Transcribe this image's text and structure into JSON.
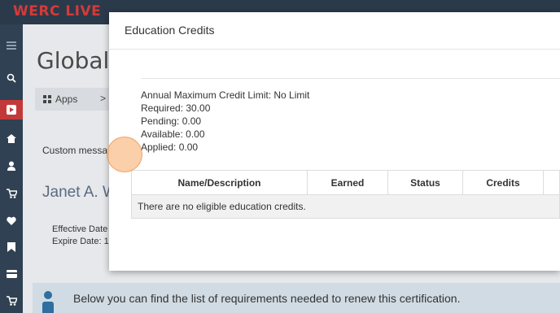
{
  "app": {
    "brand": "WERC LIVE"
  },
  "sidebar": {
    "icons": [
      "menu-icon",
      "search-icon",
      "play-icon",
      "home-icon",
      "user-icon",
      "cart-icon",
      "heart-icon",
      "bookmark-icon",
      "card-icon",
      "cart-icon"
    ],
    "active_index": 2,
    "active_color": "#c3393a"
  },
  "page": {
    "title": "Global I",
    "breadcrumb": {
      "apps_label": "Apps",
      "separator": ">"
    },
    "custom_message": "Custom messa",
    "name": "Janet A. W",
    "effective_date": "Effective Date",
    "expire_date": "Expire Date: 1",
    "info_banner": "Below you can find the list of requirements needed to renew this certification."
  },
  "modal": {
    "title": "Education Credits",
    "summary": {
      "annual_max": "Annual Maximum Credit Limit: No Limit",
      "required": "Required: 30.00",
      "pending": "Pending: 0.00",
      "available": "Available: 0.00",
      "applied": "Applied: 0.00"
    },
    "table": {
      "headers": [
        "Name/Description",
        "Earned",
        "Status",
        "Credits"
      ],
      "empty_message": "There are no eligible education credits."
    }
  },
  "colors": {
    "topbar": "#2b3a4a",
    "brand": "#d43a3a",
    "sidebar": "#2f4152",
    "cursor": "#f5a864"
  }
}
